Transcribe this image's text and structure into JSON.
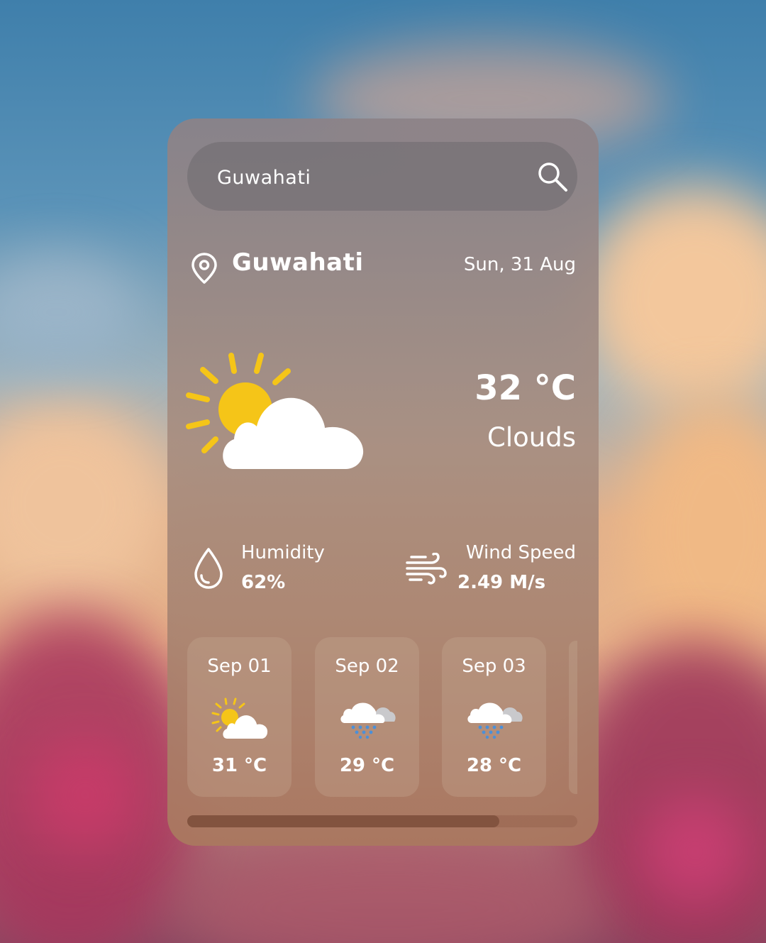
{
  "search": {
    "placeholder": "Guwahati",
    "value": "Guwahati"
  },
  "location": {
    "city": "Guwahati",
    "date": "Sun, 31 Aug"
  },
  "current": {
    "temp": "32 °C",
    "condition": "Clouds",
    "icon": "sun-cloud-icon"
  },
  "details": {
    "humidity": {
      "label": "Humidity",
      "value": "62%",
      "icon": "droplet-icon"
    },
    "wind": {
      "label": "Wind Speed",
      "value": "2.49 M/s",
      "icon": "wind-icon"
    }
  },
  "forecast": [
    {
      "date": "Sep 01",
      "temp": "31 °C",
      "icon": "sun-cloud-icon"
    },
    {
      "date": "Sep 02",
      "temp": "29 °C",
      "icon": "rain-cloud-icon"
    },
    {
      "date": "Sep 03",
      "temp": "28 °C",
      "icon": "rain-cloud-icon"
    }
  ],
  "scroll": {
    "fraction": 0.8
  },
  "colors": {
    "sun": "#f5c518",
    "cloud": "#ffffff",
    "rain": "#4a90d9"
  }
}
